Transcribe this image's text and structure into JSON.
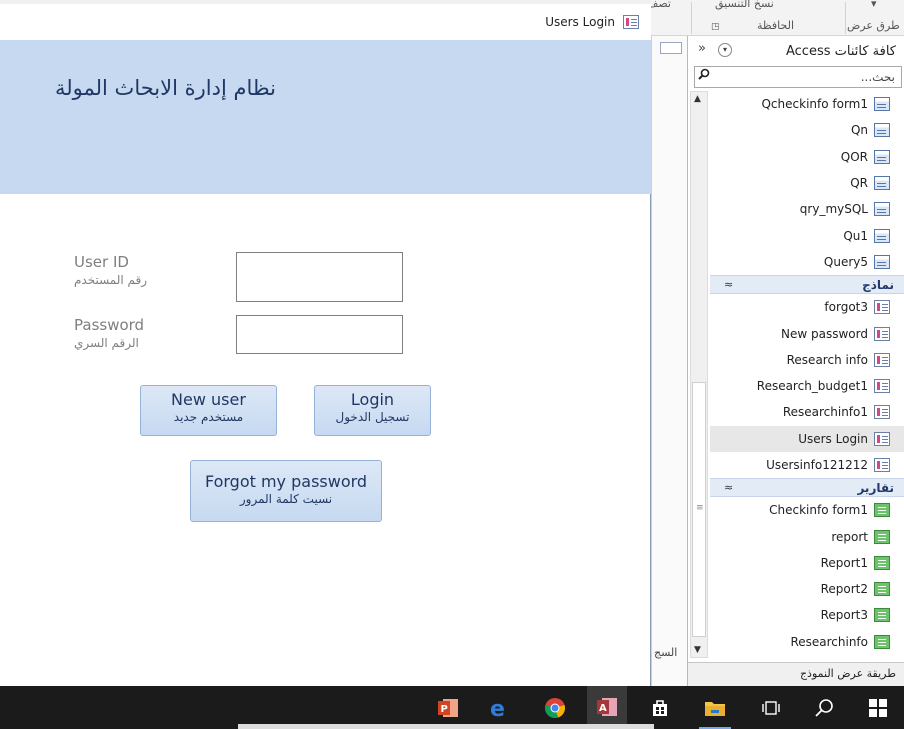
{
  "ribbon": {
    "copy_format": "نسخ التنسيق",
    "clipboard_label": "الحافظة",
    "views_label": "طرق عرض",
    "partial_label": "تصف"
  },
  "nav": {
    "title": "كافة كائنات Access",
    "search_placeholder": "بحث...",
    "queries": [
      "Qcheckinfo form1",
      "Qn",
      "QOR",
      "QR",
      "qry_mySQL",
      "Qu1",
      "Query5"
    ],
    "forms_group": "نماذج",
    "forms": [
      "forgot3",
      "New password",
      "Research info",
      "Research_budget1",
      "Researchinfo1",
      "Users Login",
      "Usersinfo121212"
    ],
    "selected_form": "Users Login",
    "reports_group": "تقارير",
    "reports": [
      "Checkinfo form1",
      "report",
      "Report1",
      "Report2",
      "Report3",
      "Researchinfo"
    ],
    "status": "طريقة عرض النموذج"
  },
  "mid": {
    "bottom_label": "السج"
  },
  "form": {
    "tab_title": "Users Login",
    "heading": "نظام إدارة الابحاث المولة",
    "user_id_label": "User ID",
    "user_id_sub": "رقم المستخدم",
    "user_id_value": "",
    "password_label": "Password",
    "password_sub": "الرقم السري",
    "password_value": "",
    "new_user_en": "New user",
    "new_user_ar": "مستخدم جديد",
    "login_en": "Login",
    "login_ar": "تسجيل الدخول",
    "forgot_en": "Forgot my password",
    "forgot_ar": "نسيت كلمة المرور"
  },
  "taskbar": {
    "apps": [
      "powerpoint-icon",
      "edge-icon",
      "chrome-icon",
      "access-icon",
      "store-icon",
      "file-explorer-icon",
      "task-view-icon",
      "search-icon",
      "windows-start-icon"
    ],
    "active": "access-icon"
  }
}
